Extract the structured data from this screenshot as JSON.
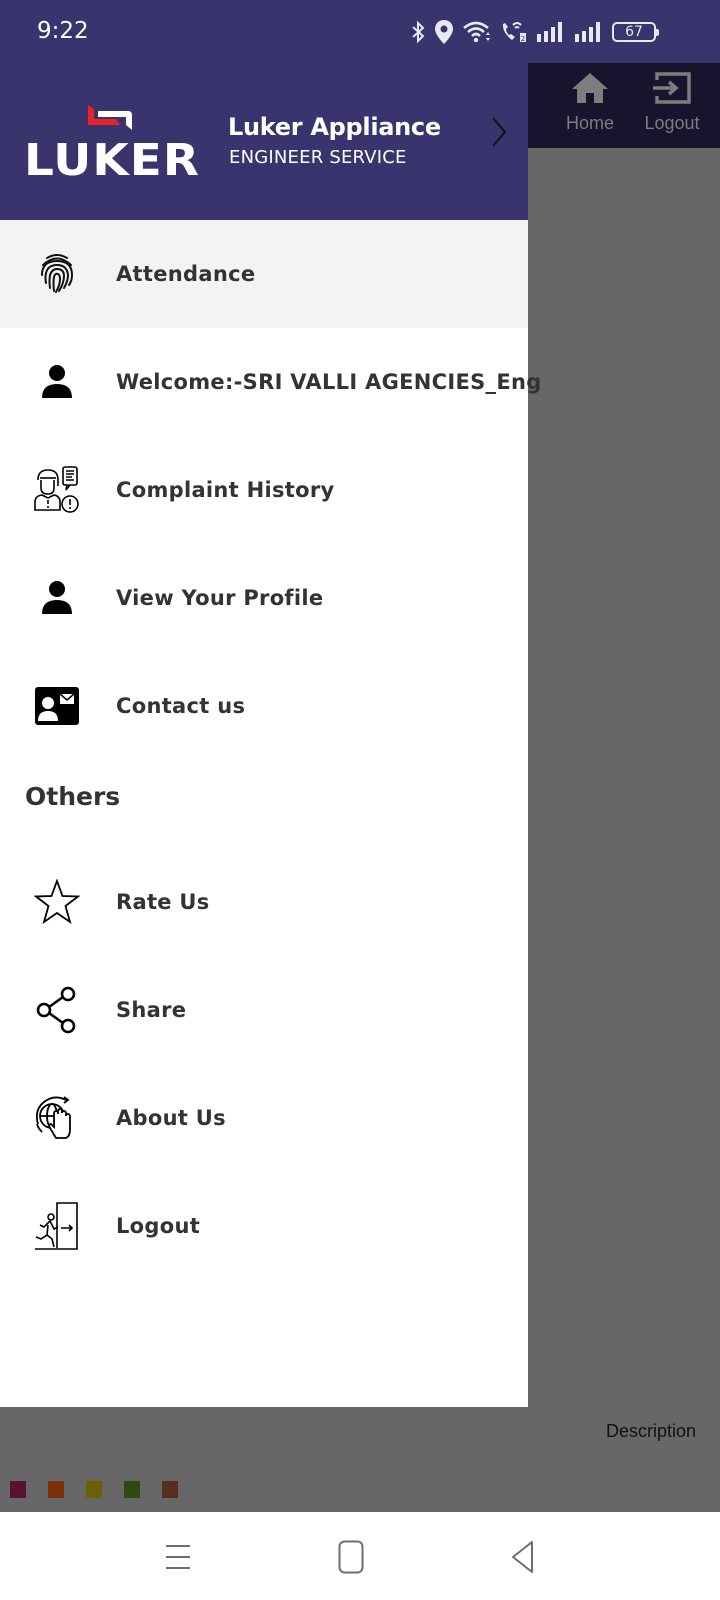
{
  "status_bar": {
    "time": "9:22",
    "battery": "67",
    "icons": [
      "bluetooth-icon",
      "location-icon",
      "wifi-icon",
      "wifi-calling-icon",
      "signal-icon",
      "signal-icon",
      "battery-icon"
    ]
  },
  "background_app": {
    "toolbar": {
      "home_label": "Home",
      "logout_label": "Logout"
    },
    "description_label": "Description",
    "swatch_colors": [
      "#5a1030",
      "#7a3008",
      "#6e5e08",
      "#2e4a10",
      "#54301a"
    ]
  },
  "drawer": {
    "header": {
      "logo_text": "LUKER",
      "title": "Luker Appliance",
      "subtitle": "ENGINEER SERVICE",
      "brand_color": "#39346e",
      "accent_color": "#e8242b"
    },
    "items": [
      {
        "label": "Attendance",
        "icon": "fingerprint-icon",
        "active": true
      },
      {
        "label": "Welcome:-SRI VALLI AGENCIES_Eng",
        "icon": "person-icon"
      },
      {
        "label": "Complaint History",
        "icon": "complaint-icon"
      },
      {
        "label": "View Your Profile",
        "icon": "person-icon"
      },
      {
        "label": "Contact us",
        "icon": "contact-card-icon"
      }
    ],
    "others_title": "Others",
    "others": [
      {
        "label": "Rate Us",
        "icon": "star-icon"
      },
      {
        "label": "Share",
        "icon": "share-icon"
      },
      {
        "label": "About Us",
        "icon": "globe-hand-icon"
      },
      {
        "label": "Logout",
        "icon": "exit-door-icon"
      }
    ]
  },
  "nav_bar": {
    "buttons": [
      "recents-button",
      "home-button",
      "back-button"
    ]
  }
}
